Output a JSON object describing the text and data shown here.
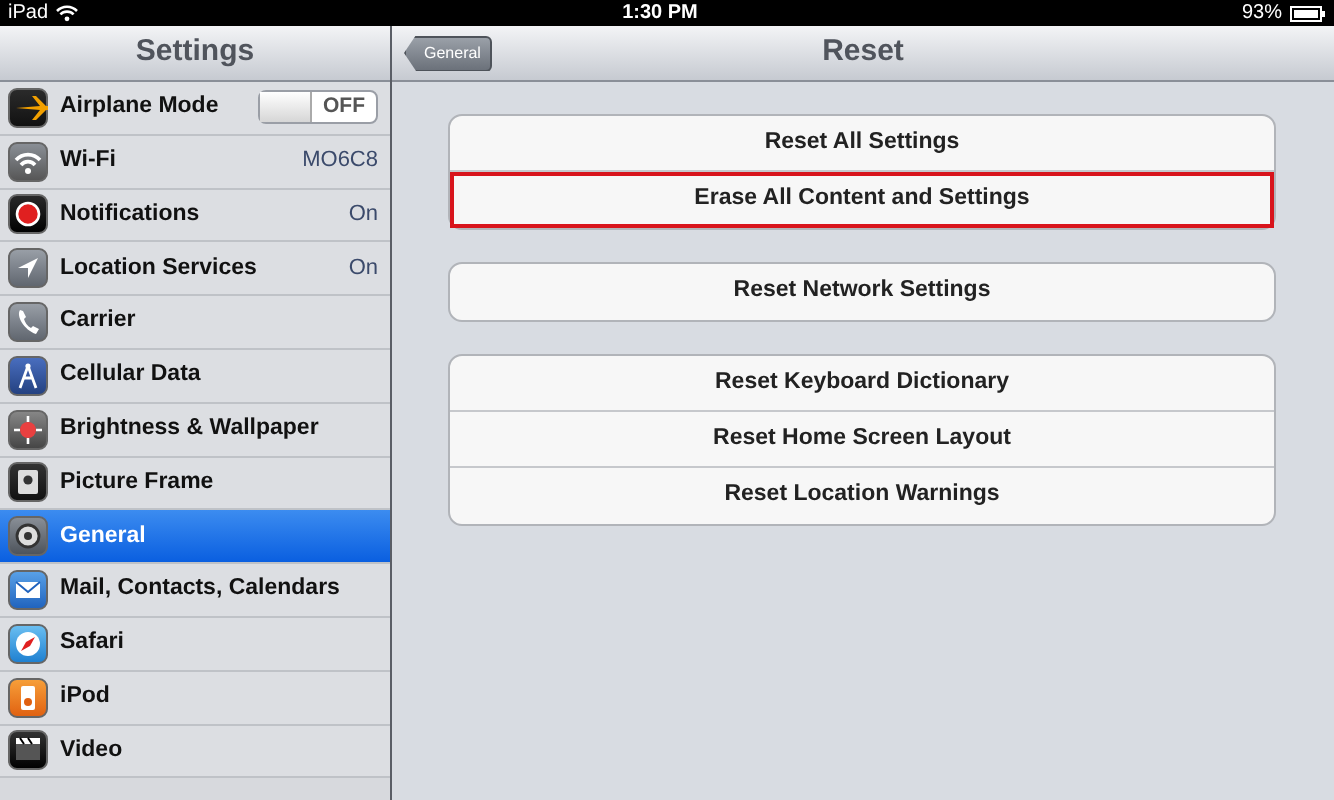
{
  "status_bar": {
    "device": "iPad",
    "time": "1:30 PM",
    "battery": "93%"
  },
  "sidebar": {
    "title": "Settings",
    "items": [
      {
        "label": "Airplane Mode",
        "kind": "switch",
        "switch_text": "OFF",
        "on": false,
        "selected": false
      },
      {
        "label": "Wi-Fi",
        "kind": "value",
        "value": "MO6C8",
        "selected": false
      },
      {
        "label": "Notifications",
        "kind": "value",
        "value": "On",
        "selected": false
      },
      {
        "label": "Location Services",
        "kind": "value",
        "value": "On",
        "selected": false
      },
      {
        "label": "Carrier",
        "kind": "plain",
        "selected": false
      },
      {
        "label": "Cellular Data",
        "kind": "plain",
        "selected": false
      },
      {
        "label": "Brightness & Wallpaper",
        "kind": "plain",
        "selected": false
      },
      {
        "label": "Picture Frame",
        "kind": "plain",
        "selected": false
      },
      {
        "label": "General",
        "kind": "plain",
        "selected": true
      },
      {
        "label": "Mail, Contacts, Calendars",
        "kind": "plain",
        "selected": false
      },
      {
        "label": "Safari",
        "kind": "plain",
        "selected": false
      },
      {
        "label": "iPod",
        "kind": "plain",
        "selected": false
      },
      {
        "label": "Video",
        "kind": "plain",
        "selected": false
      }
    ]
  },
  "detail": {
    "back_button": "General",
    "title": "Reset",
    "groups": [
      [
        {
          "label": "Reset All Settings",
          "highlighted": false
        },
        {
          "label": "Erase All Content and Settings",
          "highlighted": true
        }
      ],
      [
        {
          "label": "Reset Network Settings",
          "highlighted": false
        }
      ],
      [
        {
          "label": "Reset Keyboard Dictionary",
          "highlighted": false
        },
        {
          "label": "Reset Home Screen Layout",
          "highlighted": false
        },
        {
          "label": "Reset Location Warnings",
          "highlighted": false
        }
      ]
    ]
  }
}
